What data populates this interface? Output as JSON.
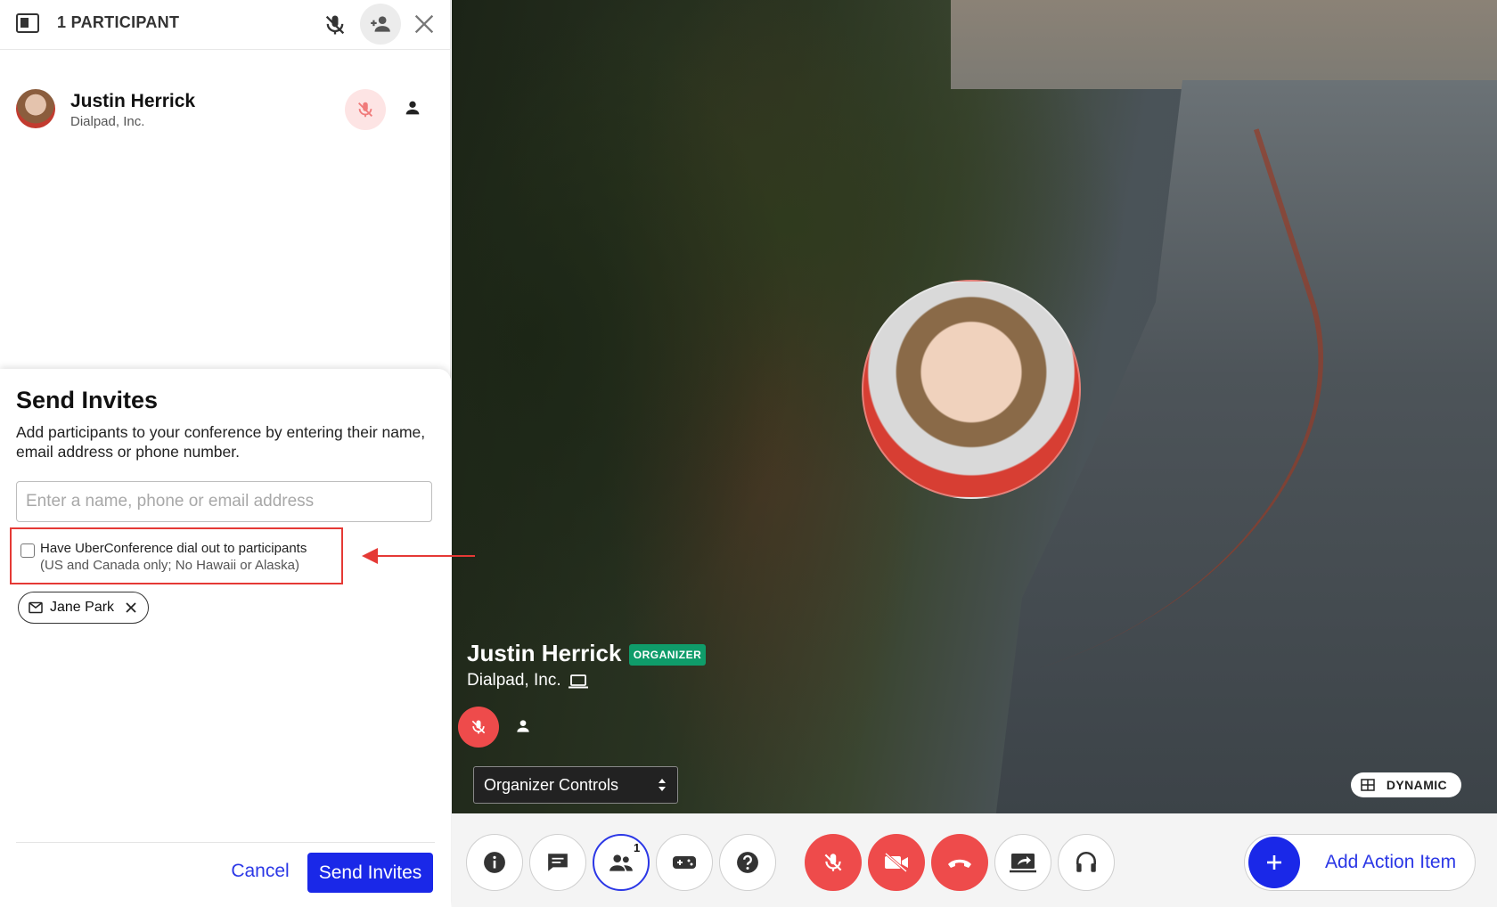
{
  "panel": {
    "participant_count": "1 PARTICIPANT",
    "icons": [
      "sidebar-toggle-icon",
      "mute-all-icon",
      "add-person-icon",
      "close-icon"
    ]
  },
  "participant": {
    "name": "Justin Herrick",
    "company": "Dialpad, Inc.",
    "muted": true
  },
  "invite": {
    "title": "Send Invites",
    "description": "Add participants to your conference by entering their name, email address or phone number.",
    "input_placeholder": "Enter a name, phone or email address",
    "input_value": "",
    "dial_out_label": "Have UberConference dial out to participants",
    "dial_out_note": "(US and Canada only; No Hawaii or Alaska)",
    "dial_out_checked": false,
    "invitees": [
      {
        "name": "Jane Park",
        "type": "email"
      }
    ],
    "cancel_label": "Cancel",
    "send_label": "Send Invites"
  },
  "stage": {
    "speaker_name": "Justin Herrick",
    "role_badge": "ORGANIZER",
    "speaker_company": "Dialpad, Inc.",
    "controls_select": "Organizer Controls",
    "layout_label": "DYNAMIC"
  },
  "toolbar": {
    "participants_badge": "1",
    "action_item_label": "Add Action Item",
    "buttons": [
      "info-icon",
      "chat-icon",
      "participants-icon",
      "game-icon",
      "help-icon",
      "mute-icon",
      "video-off-icon",
      "hang-up-icon",
      "screen-share-icon",
      "headset-icon"
    ]
  },
  "colors": {
    "brand_blue": "#1a28e8",
    "mute_red": "#ee4b4b",
    "organizer_green": "#0f9c6a",
    "annotation_red": "#e53935"
  }
}
